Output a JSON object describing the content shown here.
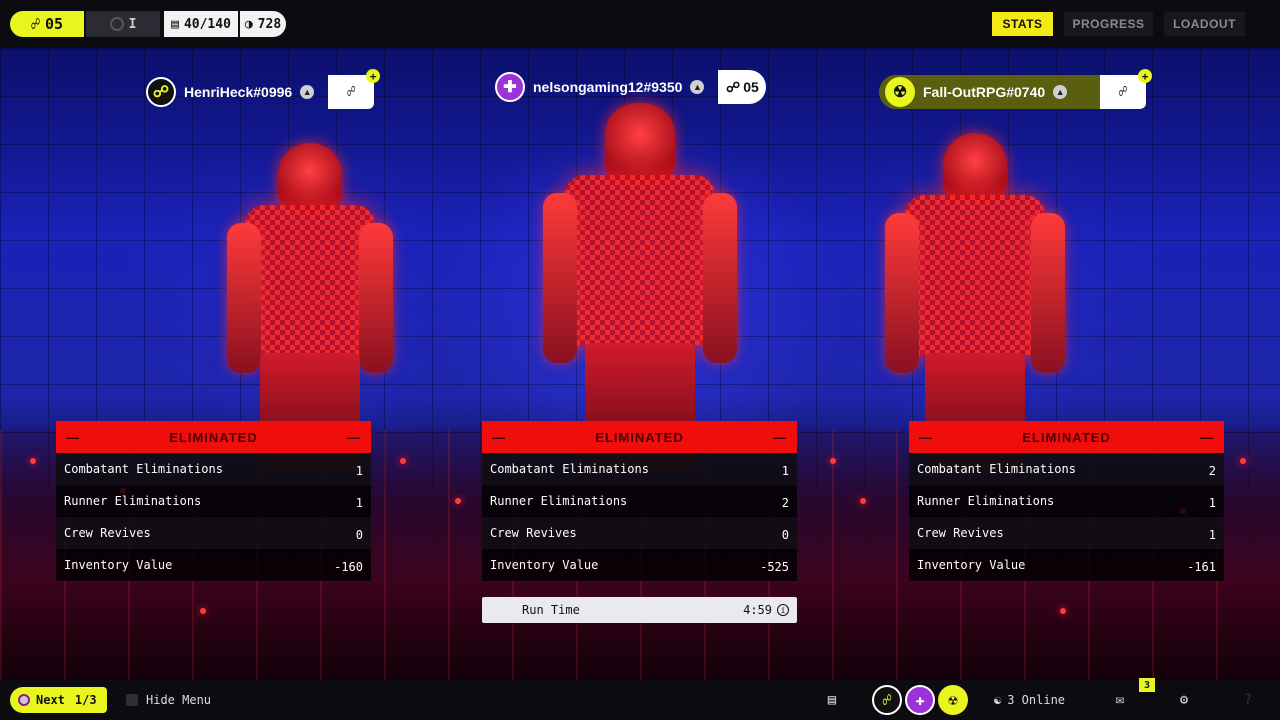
{
  "topbar": {
    "level": "05",
    "xp_indicator": "I",
    "capacity": "40/140",
    "credits": "728",
    "tabs": [
      {
        "label": "STATS",
        "active": true
      },
      {
        "label": "PROGRESS",
        "active": false
      },
      {
        "label": "LOADOUT",
        "active": false
      }
    ]
  },
  "players": [
    {
      "name": "HenriHeck#0996",
      "status": "ELIMINATED",
      "stats": [
        {
          "label": "Combatant Eliminations",
          "value": "1"
        },
        {
          "label": "Runner Eliminations",
          "value": "1"
        },
        {
          "label": "Crew Revives",
          "value": "0"
        },
        {
          "label": "Inventory Value",
          "value": "-160"
        }
      ]
    },
    {
      "name": "nelsongaming12#9350",
      "level": "05",
      "status": "ELIMINATED",
      "stats": [
        {
          "label": "Combatant Eliminations",
          "value": "1"
        },
        {
          "label": "Runner Eliminations",
          "value": "2"
        },
        {
          "label": "Crew Revives",
          "value": "0"
        },
        {
          "label": "Inventory Value",
          "value": "-525"
        }
      ]
    },
    {
      "name": "Fall-OutRPG#0740",
      "status": "ELIMINATED",
      "stats": [
        {
          "label": "Combatant Eliminations",
          "value": "2"
        },
        {
          "label": "Runner Eliminations",
          "value": "1"
        },
        {
          "label": "Crew Revives",
          "value": "1"
        },
        {
          "label": "Inventory Value",
          "value": "-161"
        }
      ]
    }
  ],
  "run_time": {
    "label": "Run Time",
    "value": "4:59"
  },
  "bottombar": {
    "next_label": "Next",
    "next_page": "1/3",
    "hide_menu_label": "Hide Menu",
    "online_label": "3 Online",
    "mail_badge": "3"
  },
  "colors": {
    "accent_yellow": "#e8f51f",
    "eliminated_red": "#f20d0d",
    "panel_bg": "#0e0e12"
  },
  "icons": [
    "headset-icon",
    "capacity-icon",
    "credits-icon",
    "playstation-icon",
    "link-icon",
    "plus-icon",
    "info-icon",
    "chat-icon",
    "people-icon",
    "mail-icon",
    "gear-icon",
    "help-icon"
  ]
}
